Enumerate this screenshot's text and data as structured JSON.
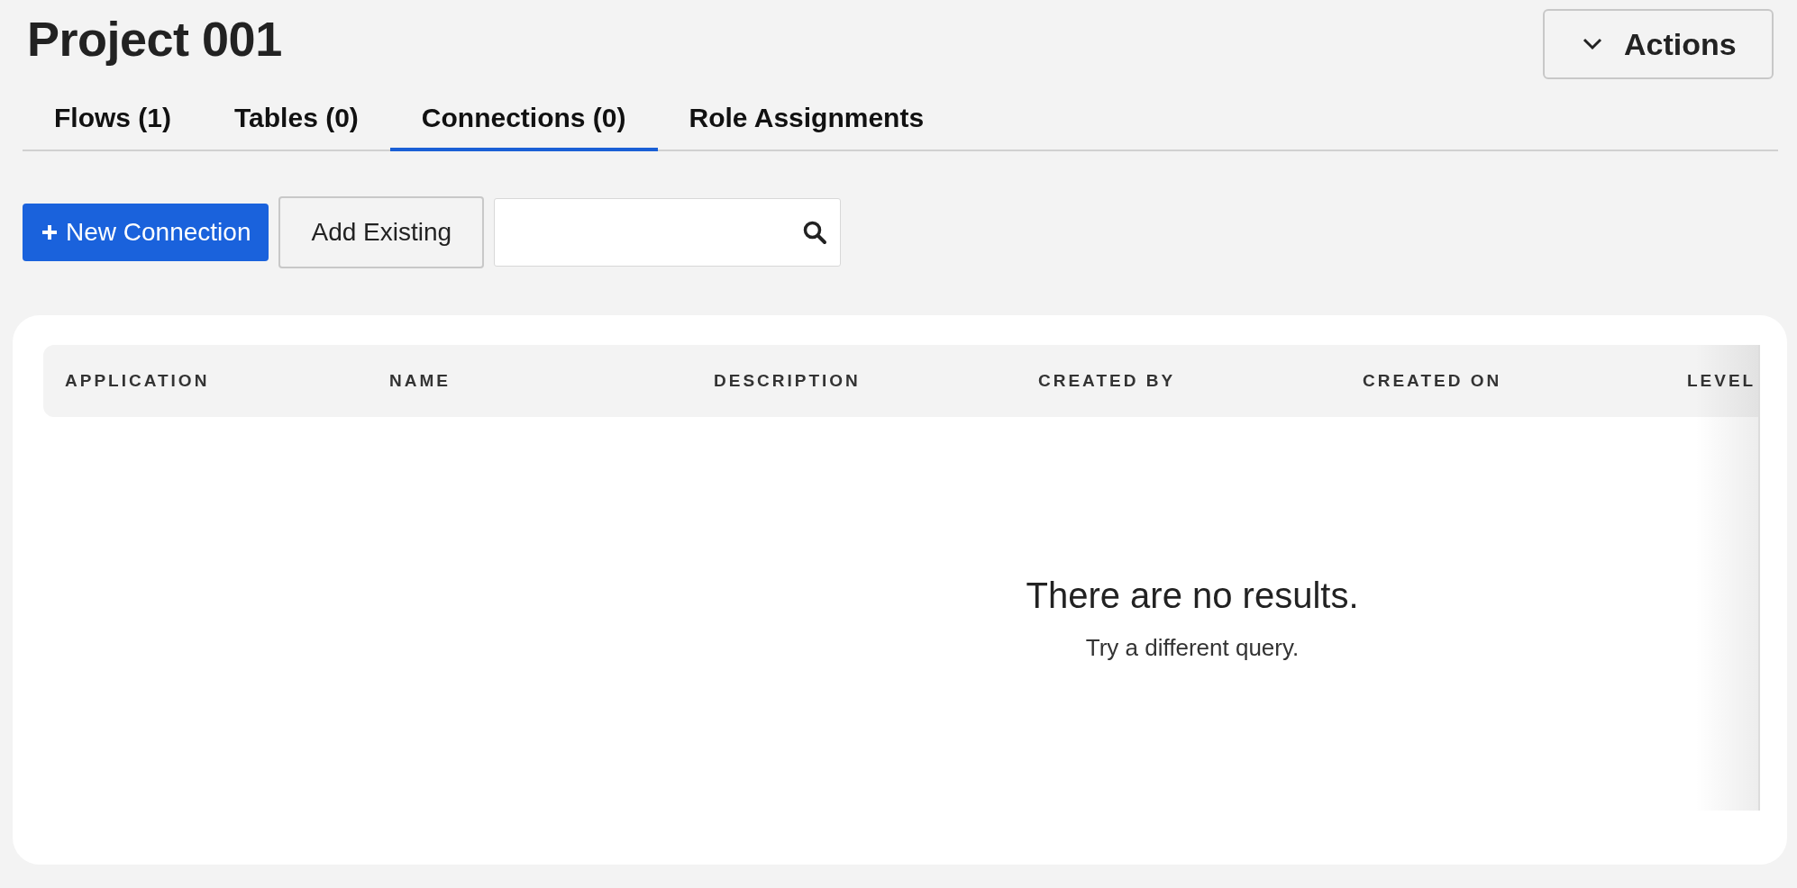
{
  "page": {
    "title": "Project 001"
  },
  "actions_button": {
    "label": "Actions"
  },
  "tabs": [
    {
      "label": "Flows (1)",
      "selected": false
    },
    {
      "label": "Tables (0)",
      "selected": false
    },
    {
      "label": "Connections (0)",
      "selected": true
    },
    {
      "label": "Role Assignments",
      "selected": false
    }
  ],
  "toolbar": {
    "new_button": "New Connection",
    "add_button": "Add Existing"
  },
  "table": {
    "columns": [
      "APPLICATION",
      "NAME",
      "DESCRIPTION",
      "CREATED BY",
      "CREATED ON",
      "LEVEL"
    ],
    "empty_title": "There are no results.",
    "empty_hint": "Try a different query."
  }
}
